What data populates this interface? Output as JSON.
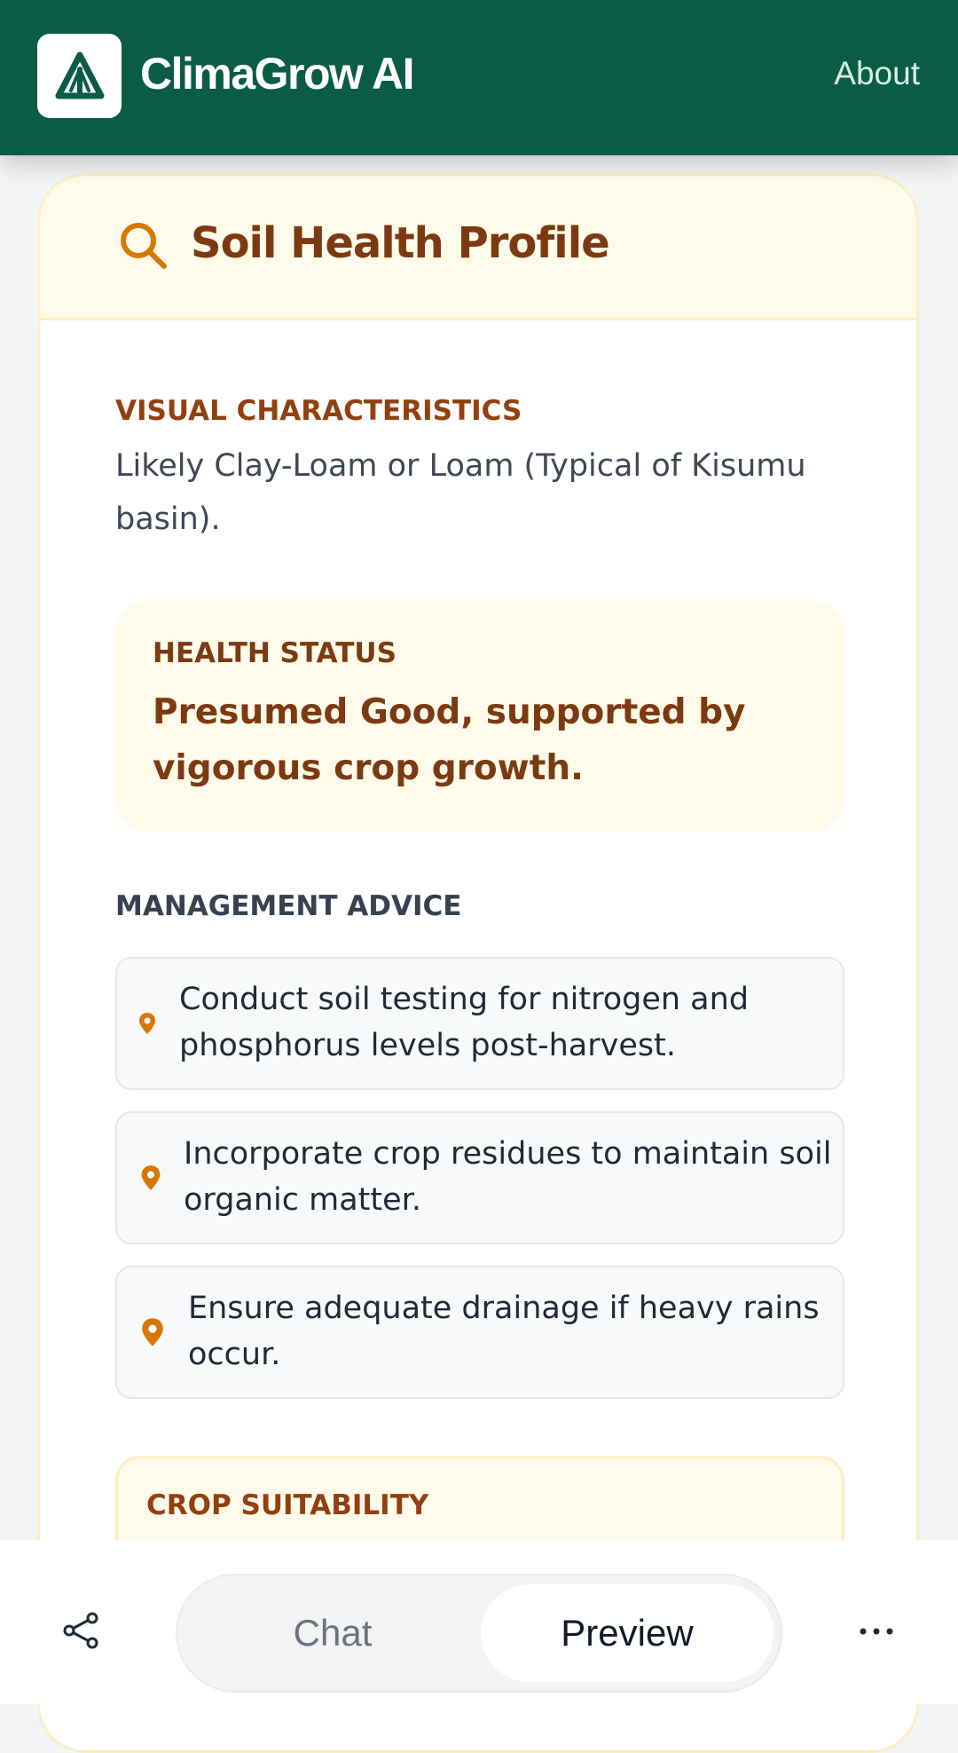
{
  "header": {
    "brand": "ClimaGrow AI",
    "about_label": "About",
    "brand_color": "#0a5c45",
    "logo_icon": "triangle-leaf-logo-icon"
  },
  "card": {
    "title": "Soil Health Profile",
    "title_icon": "search-icon",
    "visual": {
      "label": "VISUAL CHARACTERISTICS",
      "text_line1": "Likely Clay-Loam or Loam (Typical of Kisumu",
      "text_line2": "basin)."
    },
    "health": {
      "label": "HEALTH STATUS",
      "text_line1": "Presumed Good, supported by",
      "text_line2": "vigorous crop growth."
    },
    "management": {
      "label": "MANAGEMENT ADVICE",
      "items": [
        {
          "line1": "Conduct soil testing for nitrogen and",
          "line2": "phosphorus levels post-harvest."
        },
        {
          "line1": "Incorporate crop residues to maintain soil",
          "line2": "organic matter."
        },
        {
          "line1": "Ensure adequate drainage if heavy rains",
          "line2": "occur."
        }
      ],
      "item_icon": "map-pin-icon"
    },
    "crop": {
      "label": "CROP SUITABILITY"
    }
  },
  "bottom_bar": {
    "chat_label": "Chat",
    "preview_label": "Preview",
    "active_tab": "Preview",
    "share_icon": "share-icon",
    "more_icon": "more-dots-icon"
  },
  "colors": {
    "accent": "#d97706",
    "heading_brown": "#7c3a12",
    "card_border": "#fbefc5"
  }
}
